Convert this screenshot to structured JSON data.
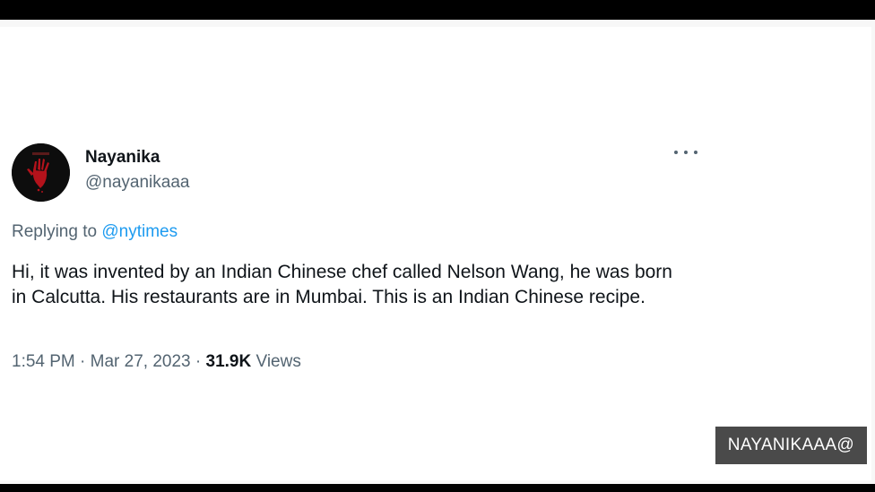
{
  "tweet": {
    "display_name": "Nayanika",
    "handle": "@nayanikaaa",
    "replying_prefix": "Replying to",
    "replying_to": "@nytimes",
    "text": "Hi, it was invented by an Indian Chinese chef called Nelson Wang, he was born in Calcutta. His restaurants are in Mumbai. This is an Indian Chinese recipe.",
    "time": "1:54 PM",
    "date": "Mar 27, 2023",
    "separator": "·",
    "views_count": "31.9K",
    "views_label": "Views",
    "avatar_icon": "red-hand-icon",
    "more_icon": "more-options-icon"
  },
  "watermark": {
    "text": "NAYANIKAAA@"
  },
  "colors": {
    "link": "#1d9bf0",
    "secondary_text": "#536471",
    "primary_text": "#0f1419",
    "watermark_bg": "#4a4a4a"
  }
}
